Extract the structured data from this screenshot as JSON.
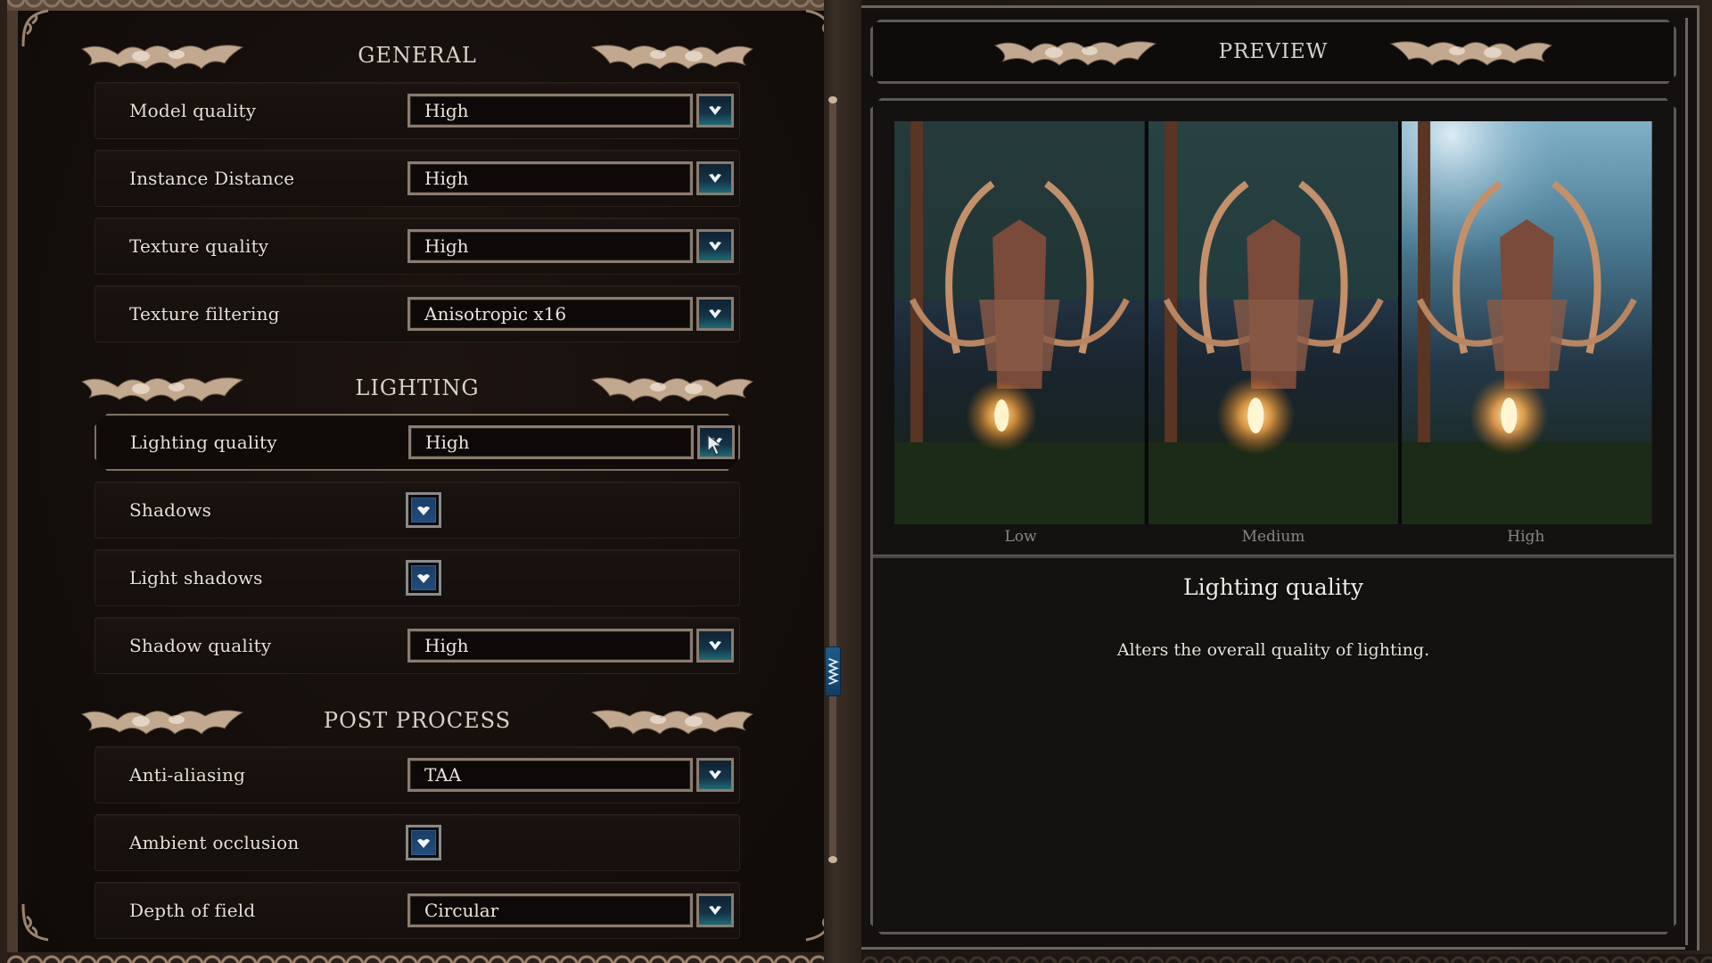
{
  "left_panel": {
    "sections": [
      {
        "title": "GENERAL",
        "rows": [
          {
            "label": "Model quality",
            "type": "select",
            "value": "High"
          },
          {
            "label": "Instance Distance",
            "type": "select",
            "value": "High"
          },
          {
            "label": "Texture quality",
            "type": "select",
            "value": "High"
          },
          {
            "label": "Texture filtering",
            "type": "select",
            "value": "Anisotropic x16"
          }
        ]
      },
      {
        "title": "LIGHTING",
        "rows": [
          {
            "label": "Lighting quality",
            "type": "select",
            "value": "High",
            "active": true
          },
          {
            "label": "Shadows",
            "type": "checkbox",
            "checked": true
          },
          {
            "label": "Light shadows",
            "type": "checkbox",
            "checked": true
          },
          {
            "label": "Shadow quality",
            "type": "select",
            "value": "High"
          }
        ]
      },
      {
        "title": "POST PROCESS",
        "rows": [
          {
            "label": "Anti-aliasing",
            "type": "select",
            "value": "TAA"
          },
          {
            "label": "Ambient occlusion",
            "type": "checkbox",
            "checked": true
          },
          {
            "label": "Depth of field",
            "type": "select",
            "value": "Circular"
          }
        ]
      }
    ]
  },
  "scrollbar": {
    "position_fraction": 0.72
  },
  "preview": {
    "title": "PREVIEW",
    "images": [
      {
        "label": "Low"
      },
      {
        "label": "Medium"
      },
      {
        "label": "High"
      }
    ],
    "description_title": "Lighting quality",
    "description_text": "Alters the overall quality of lighting."
  },
  "icons": {
    "dropdown": "chevron-down-icon",
    "checkbox": "checkmark-icon",
    "ornament": "filigree-ornament-icon",
    "cursor": "mouse-pointer-icon",
    "scroll_thumb": "scroll-grip-icon"
  },
  "colors": {
    "accent_blue": "#1d5a8a",
    "frame_silver": "#8a7c70",
    "ornament_bronze": "#c2a88e"
  }
}
